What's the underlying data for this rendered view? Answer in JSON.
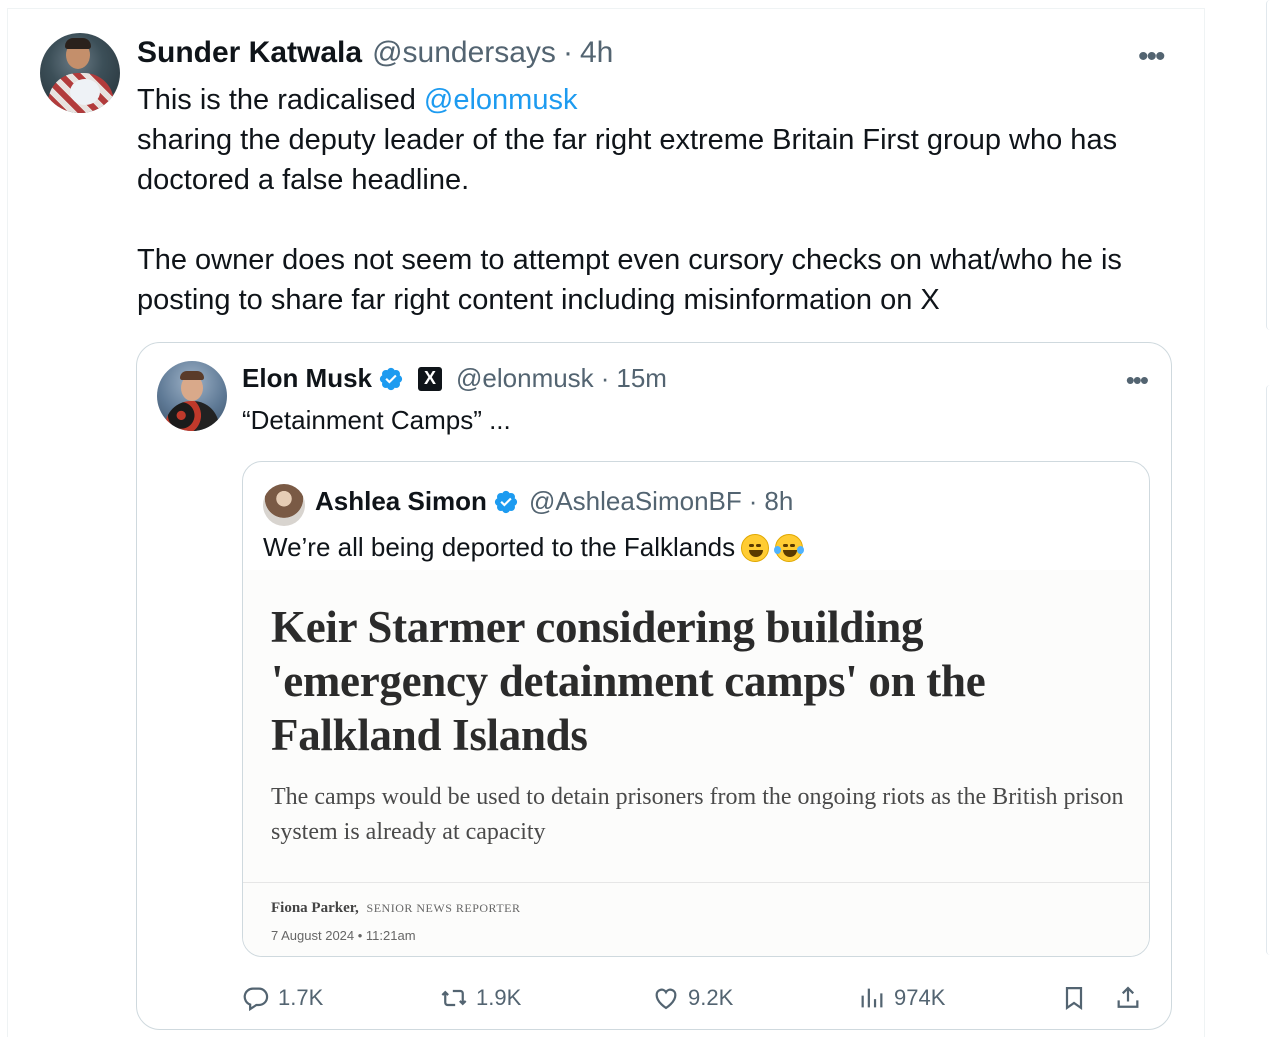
{
  "tweet": {
    "author_name": "Sunder Katwala",
    "handle": "@sundersays",
    "separator": "·",
    "time": "4h",
    "more": "•••",
    "text_line1_prefix": "This is the radicalised ",
    "text_mention": "@elonmusk",
    "text_line2": "sharing the deputy leader of the far right extreme Britain First group who has doctored a false headline.",
    "text_para2": "The owner does not seem to attempt even cursory checks on what/who he is posting to share far right content including misinformation on X"
  },
  "quote1": {
    "author_name": "Elon Musk",
    "badge_x": "X",
    "handle": "@elonmusk",
    "separator": "·",
    "time": "15m",
    "more": "•••",
    "text": "“Detainment Camps” ..."
  },
  "quote2": {
    "author_name": "Ashlea Simon",
    "handle": "@AshleaSimonBF",
    "separator": "·",
    "time": "8h",
    "text": "We’re all being deported to the Falklands",
    "emojis": [
      "grinning-sweat-emoji",
      "tears-of-joy-emoji"
    ],
    "article": {
      "headline": "Keir Starmer considering building 'emergency detainment camps' on the Falkland Islands",
      "standfirst": "The camps would be used to detain prisoners from the ongoing riots as the British prison system is already at capacity",
      "author": "Fiona Parker,",
      "role": "SENIOR NEWS REPORTER",
      "date": "7 August 2024 • 11:21am"
    }
  },
  "actions": {
    "replies": "1.7K",
    "reposts": "1.9K",
    "likes": "9.2K",
    "views": "974K"
  },
  "colors": {
    "accent": "#1d9bf0",
    "text": "#0f1419",
    "muted": "#536471",
    "border": "#cfd9de"
  }
}
